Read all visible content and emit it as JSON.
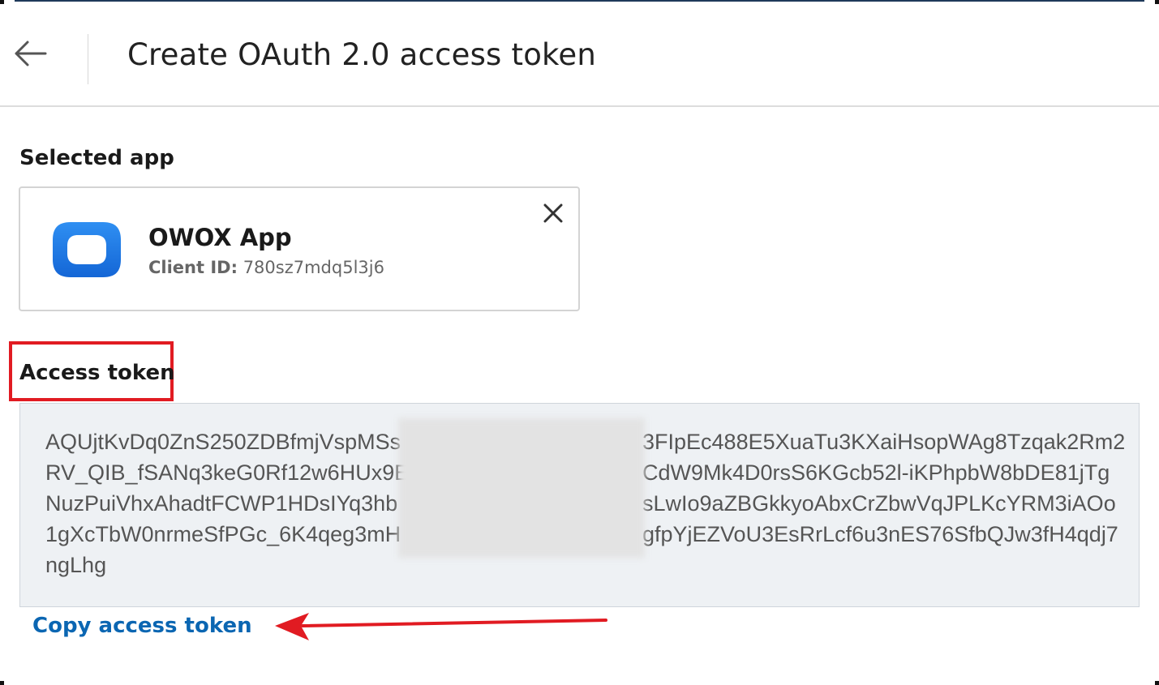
{
  "header": {
    "title": "Create OAuth 2.0 access token",
    "back_icon": "arrow-left-icon"
  },
  "selected_app": {
    "section_label": "Selected app",
    "app_name": "OWOX App",
    "client_id_label": "Client ID:",
    "client_id_value": "780sz7mdq5l3j6",
    "logo_icon": "owox-logo-icon",
    "remove_icon": "close-icon"
  },
  "access_token": {
    "section_label": "Access token",
    "lines": [
      [
        "AQUjtKvDq0ZnS250ZDBfmjVspMSs",
        "3FIpEc488E5XuaTu3KXaiHsopWAg8Tzqak2Rm2"
      ],
      [
        "RV_QIB_fSANq3keG0Rf12w6HUx9E",
        "CdW9Mk4D0rsS6KGcb52l-iKPhpbW8bDE81jTg"
      ],
      [
        "NuzPuiVhxAhadtFCWP1HDsIYq3hb",
        "sLwIo9aZBGkkyoAbxCrZbwVqJPLKcYRM3iAOo"
      ],
      [
        "1gXcTbW0nrmeSfPGc_6K4qeg3mH",
        "gfpYjEZVoU3EsRrLcf6u3nES76SfbQJw3fH4qdj7"
      ],
      [
        "ngLhg",
        ""
      ]
    ],
    "copy_link": "Copy access token"
  },
  "colors": {
    "link": "#0b66b2",
    "annotation": "#e11b22",
    "token_background": "#eef1f4",
    "logo": "#1a7fe8"
  }
}
